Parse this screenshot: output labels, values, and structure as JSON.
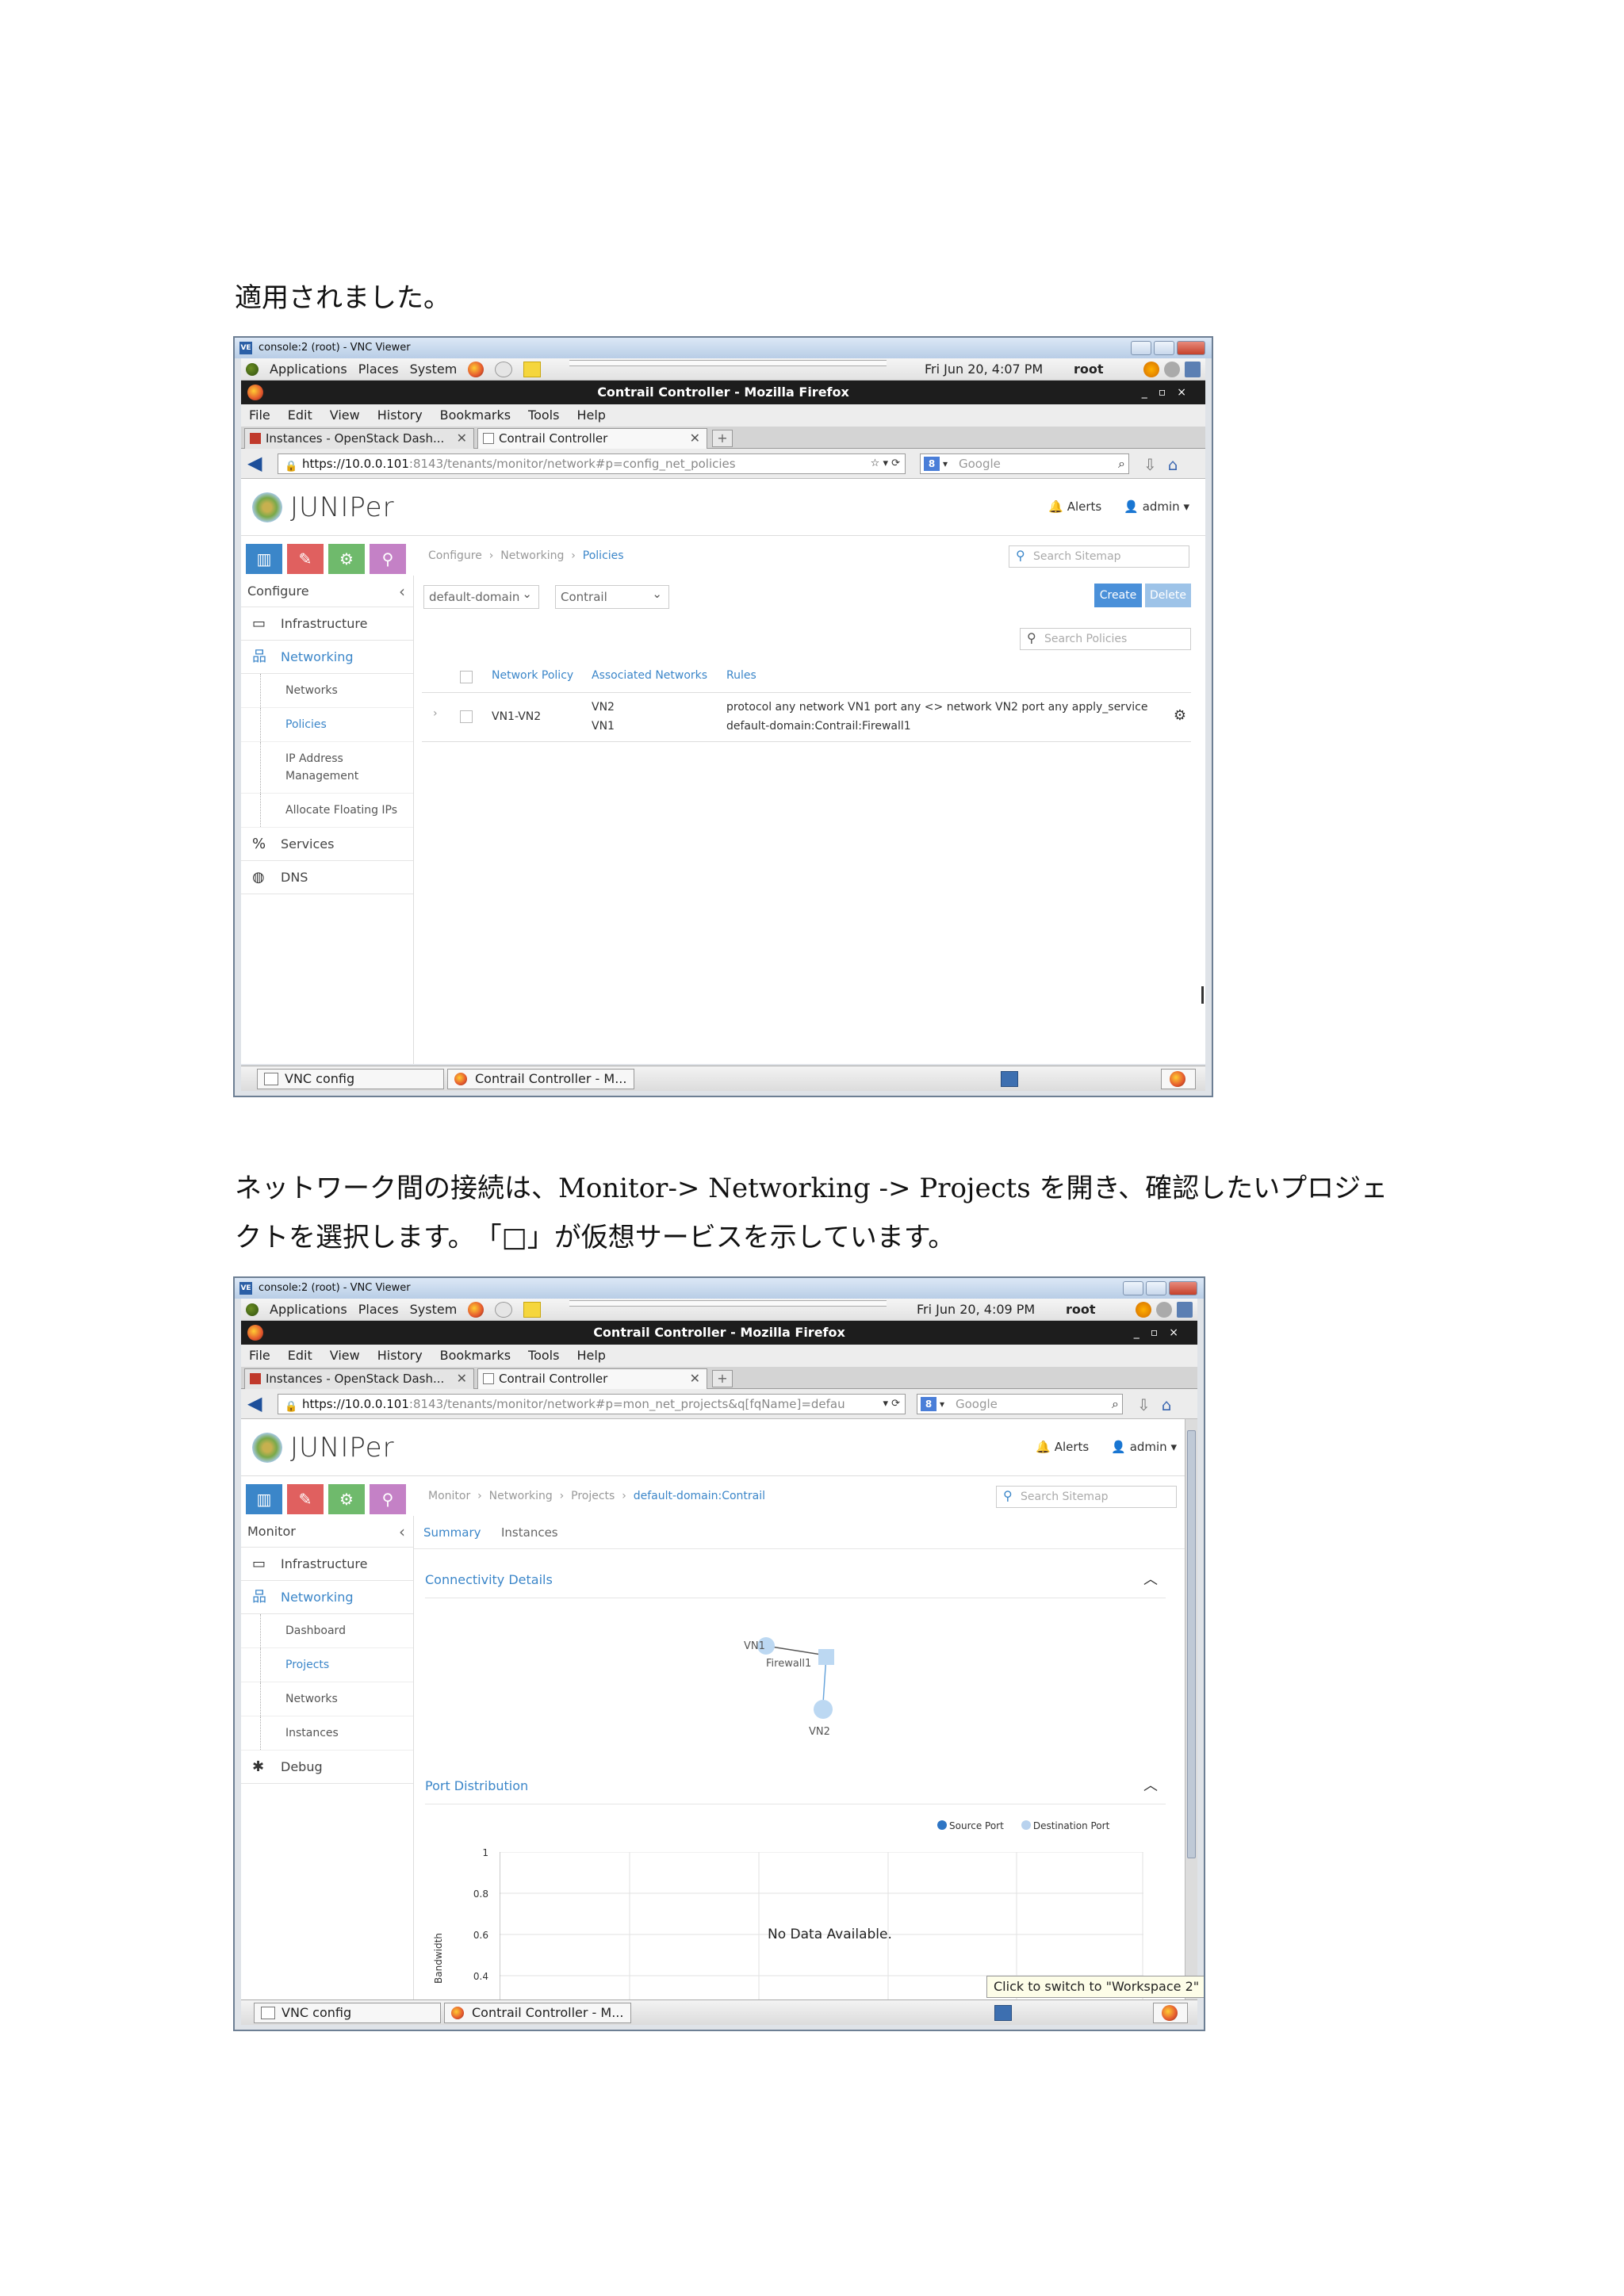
{
  "doc": {
    "line1": "適用されました。",
    "line2": "ネットワーク間の接続は、Monitor-> Networking -> Projects を開き、確認したいプロジェ",
    "line3": "クトを選択します。　「□」が仮想サービスを示しています。"
  },
  "shot1": {
    "vnc_title": "console:2 (root) - VNC Viewer",
    "panel": {
      "applications": "Applications",
      "places": "Places",
      "system": "System",
      "clock": "Fri Jun 20,  4:07 PM",
      "user": "root"
    },
    "window_title": "Contrail Controller - Mozilla Firefox",
    "menu": [
      "File",
      "Edit",
      "View",
      "History",
      "Bookmarks",
      "Tools",
      "Help"
    ],
    "tabs": [
      "Instances - OpenStack Dash...",
      "Contrail Controller"
    ],
    "url_host": "https://10.0.0.101",
    "url_rest": ":8143/tenants/monitor/network#p=config_net_policies",
    "search_engine": "Google",
    "header": {
      "logo": "JUNIPer",
      "alerts": "Alerts",
      "user": "admin"
    },
    "breadcrumb": [
      "Configure",
      "Networking",
      "Policies"
    ],
    "sitemap_placeholder": "Search Sitemap",
    "sidebar": {
      "title": "Configure",
      "infrastructure": "Infrastructure",
      "networking": "Networking",
      "subs": [
        "Networks",
        "Policies",
        "IP Address Management",
        "Allocate Floating IPs"
      ],
      "services": "Services",
      "dns": "DNS"
    },
    "domain_select": "default-domain",
    "project_select": "Contrail",
    "create": "Create",
    "delete": "Delete",
    "search_policies": "Search Policies",
    "table": {
      "headers": [
        "Network Policy",
        "Associated Networks",
        "Rules"
      ],
      "row": {
        "policy": "VN1-VN2",
        "networks": [
          "VN2",
          "VN1"
        ],
        "rules": [
          "protocol any network VN1 port any <> network VN2 port any apply_service",
          "default-domain:Contrail:Firewall1"
        ]
      }
    },
    "taskbar": [
      "VNC config",
      "Contrail Controller - M..."
    ]
  },
  "shot2": {
    "vnc_title": "console:2 (root) - VNC Viewer",
    "panel": {
      "applications": "Applications",
      "places": "Places",
      "system": "System",
      "clock": "Fri Jun 20,  4:09 PM",
      "user": "root"
    },
    "window_title": "Contrail Controller - Mozilla Firefox",
    "menu": [
      "File",
      "Edit",
      "View",
      "History",
      "Bookmarks",
      "Tools",
      "Help"
    ],
    "tabs": [
      "Instances - OpenStack Dash...",
      "Contrail Controller"
    ],
    "url_host": "https://10.0.0.101",
    "url_rest": ":8143/tenants/monitor/network#p=mon_net_projects&q[fqName]=defau",
    "search_engine": "Google",
    "header": {
      "logo": "JUNIPer",
      "alerts": "Alerts",
      "user": "admin"
    },
    "breadcrumb": [
      "Monitor",
      "Networking",
      "Projects",
      "default-domain:Contrail"
    ],
    "sitemap_placeholder": "Search Sitemap",
    "sidebar": {
      "title": "Monitor",
      "infrastructure": "Infrastructure",
      "networking": "Networking",
      "subs": [
        "Dashboard",
        "Projects",
        "Networks",
        "Instances"
      ],
      "debug": "Debug"
    },
    "content_tabs": [
      "Summary",
      "Instances"
    ],
    "connectivity": {
      "title": "Connectivity Details",
      "nodes": [
        "VN1",
        "Firewall1",
        "VN2"
      ]
    },
    "port_dist": {
      "title": "Port Distribution",
      "legend": [
        "Source Port",
        "Destination Port"
      ],
      "ylabel": "Bandwidth",
      "yticks": [
        "1",
        "0.8",
        "0.6",
        "0.4"
      ],
      "nodata": "No Data Available."
    },
    "tooltip": "Click to switch to \"Workspace 2\"",
    "taskbar": [
      "VNC config",
      "Contrail Controller - M..."
    ]
  },
  "colors": {
    "accent": "#3b86c9",
    "monitor": "#3b86c9",
    "configure": "#e0605f",
    "settings": "#6fba6c",
    "query": "#c481c6",
    "create": "#4a90d9",
    "delete": "#9dc3e8"
  }
}
